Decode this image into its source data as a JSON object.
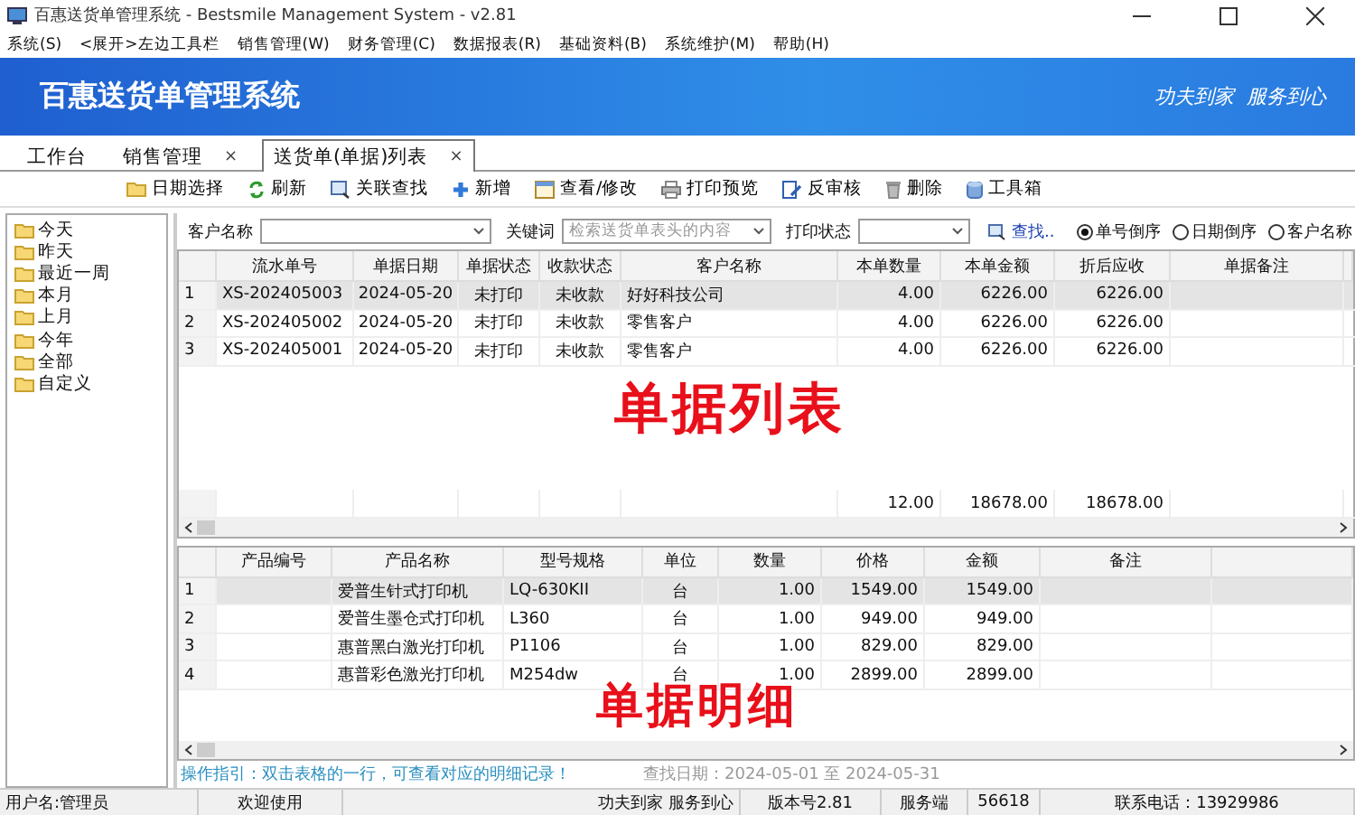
{
  "window": {
    "title": "百惠送货单管理系统 - Bestsmile Management System - v2.81"
  },
  "menu": [
    "系统(S)",
    "<展开>左边工具栏",
    "销售管理(W)",
    "财务管理(C)",
    "数据报表(R)",
    "基础资料(B)",
    "系统维护(M)",
    "帮助(H)"
  ],
  "banner": {
    "title": "百惠送货单管理系统",
    "slogan": "功夫到家  服务到心"
  },
  "tabs": [
    {
      "label": "工作台",
      "selected": false
    },
    {
      "label": "销售管理",
      "selected": false,
      "close": "×"
    },
    {
      "label": "送货单(单据)列表",
      "selected": true,
      "close": "×"
    }
  ],
  "toolbar": [
    {
      "kind": "folder",
      "label": "日期选择"
    },
    {
      "kind": "refresh",
      "label": "刷新"
    },
    {
      "kind": "search",
      "label": "关联查找"
    },
    {
      "kind": "add",
      "label": "新增"
    },
    {
      "kind": "edit",
      "label": "查看/修改"
    },
    {
      "kind": "print",
      "label": "打印预览"
    },
    {
      "kind": "review",
      "label": "反审核"
    },
    {
      "kind": "delete",
      "label": "删除"
    },
    {
      "kind": "toolbox",
      "label": "工具箱"
    }
  ],
  "date_tree": [
    "今天",
    "昨天",
    "最近一周",
    "本月",
    "上月",
    "今年",
    "全部",
    "自定义"
  ],
  "filters": {
    "customer_label": "客户名称",
    "keyword_label": "关键词",
    "keyword_placeholder": "检索送货单表头的内容",
    "print_status_label": "打印状态",
    "find": "查找..",
    "sort": [
      {
        "label": "单号倒序",
        "selected": true
      },
      {
        "label": "日期倒序",
        "selected": false
      },
      {
        "label": "客户名称",
        "selected": false
      }
    ]
  },
  "orders": {
    "columns": [
      "流水单号",
      "单据日期",
      "单据状态",
      "收款状态",
      "客户名称",
      "本单数量",
      "本单金额",
      "折后应收",
      "单据备注"
    ],
    "rows": [
      {
        "number": "1",
        "selected": true,
        "cells": [
          "XS-202405003",
          "2024-05-20",
          "未打印",
          "未收款",
          "好好科技公司",
          "4.00",
          "6226.00",
          "6226.00"
        ]
      },
      {
        "number": "2",
        "selected": false,
        "cells": [
          "XS-202405002",
          "2024-05-20",
          "未打印",
          "未收款",
          "零售客户",
          "4.00",
          "6226.00",
          "6226.00"
        ]
      },
      {
        "number": "3",
        "selected": false,
        "cells": [
          "XS-202405001",
          "2024-05-20",
          "未打印",
          "未收款",
          "零售客户",
          "4.00",
          "6226.00",
          "6226.00"
        ]
      }
    ],
    "totals": [
      "12.00",
      "18678.00",
      "18678.00"
    ]
  },
  "details": {
    "columns": [
      "产品编号",
      "产品名称",
      "型号规格",
      "单位",
      "数量",
      "价格",
      "金额",
      "备注"
    ],
    "rows": [
      {
        "number": "1",
        "selected": true,
        "cells": [
          "",
          "爱普生针式打印机",
          "LQ-630KII",
          "台",
          "1.00",
          "1549.00",
          "1549.00"
        ]
      },
      {
        "number": "2",
        "selected": false,
        "cells": [
          "",
          "爱普生墨仓式打印机",
          "L360",
          "台",
          "1.00",
          "949.00",
          "949.00"
        ]
      },
      {
        "number": "3",
        "selected": false,
        "cells": [
          "",
          "惠普黑白激光打印机",
          "P1106",
          "台",
          "1.00",
          "829.00",
          "829.00"
        ]
      },
      {
        "number": "4",
        "selected": false,
        "cells": [
          "",
          "惠普彩色激光打印机",
          "M254dw",
          "台",
          "1.00",
          "2899.00",
          "2899.00"
        ]
      }
    ]
  },
  "guide": "操作指引：双击表格的一行，可查看对应的明细记录！",
  "search_date": "查找日期：2024-05-01 至 2024-05-31",
  "status_bar": [
    "用户名:管理员",
    "欢迎使用",
    "功夫到家 服务到心",
    "版本号2.81",
    "服务端",
    "56618",
    "联系电话：13929986"
  ],
  "annotations": [
    "单据列表",
    "单据明细"
  ]
}
